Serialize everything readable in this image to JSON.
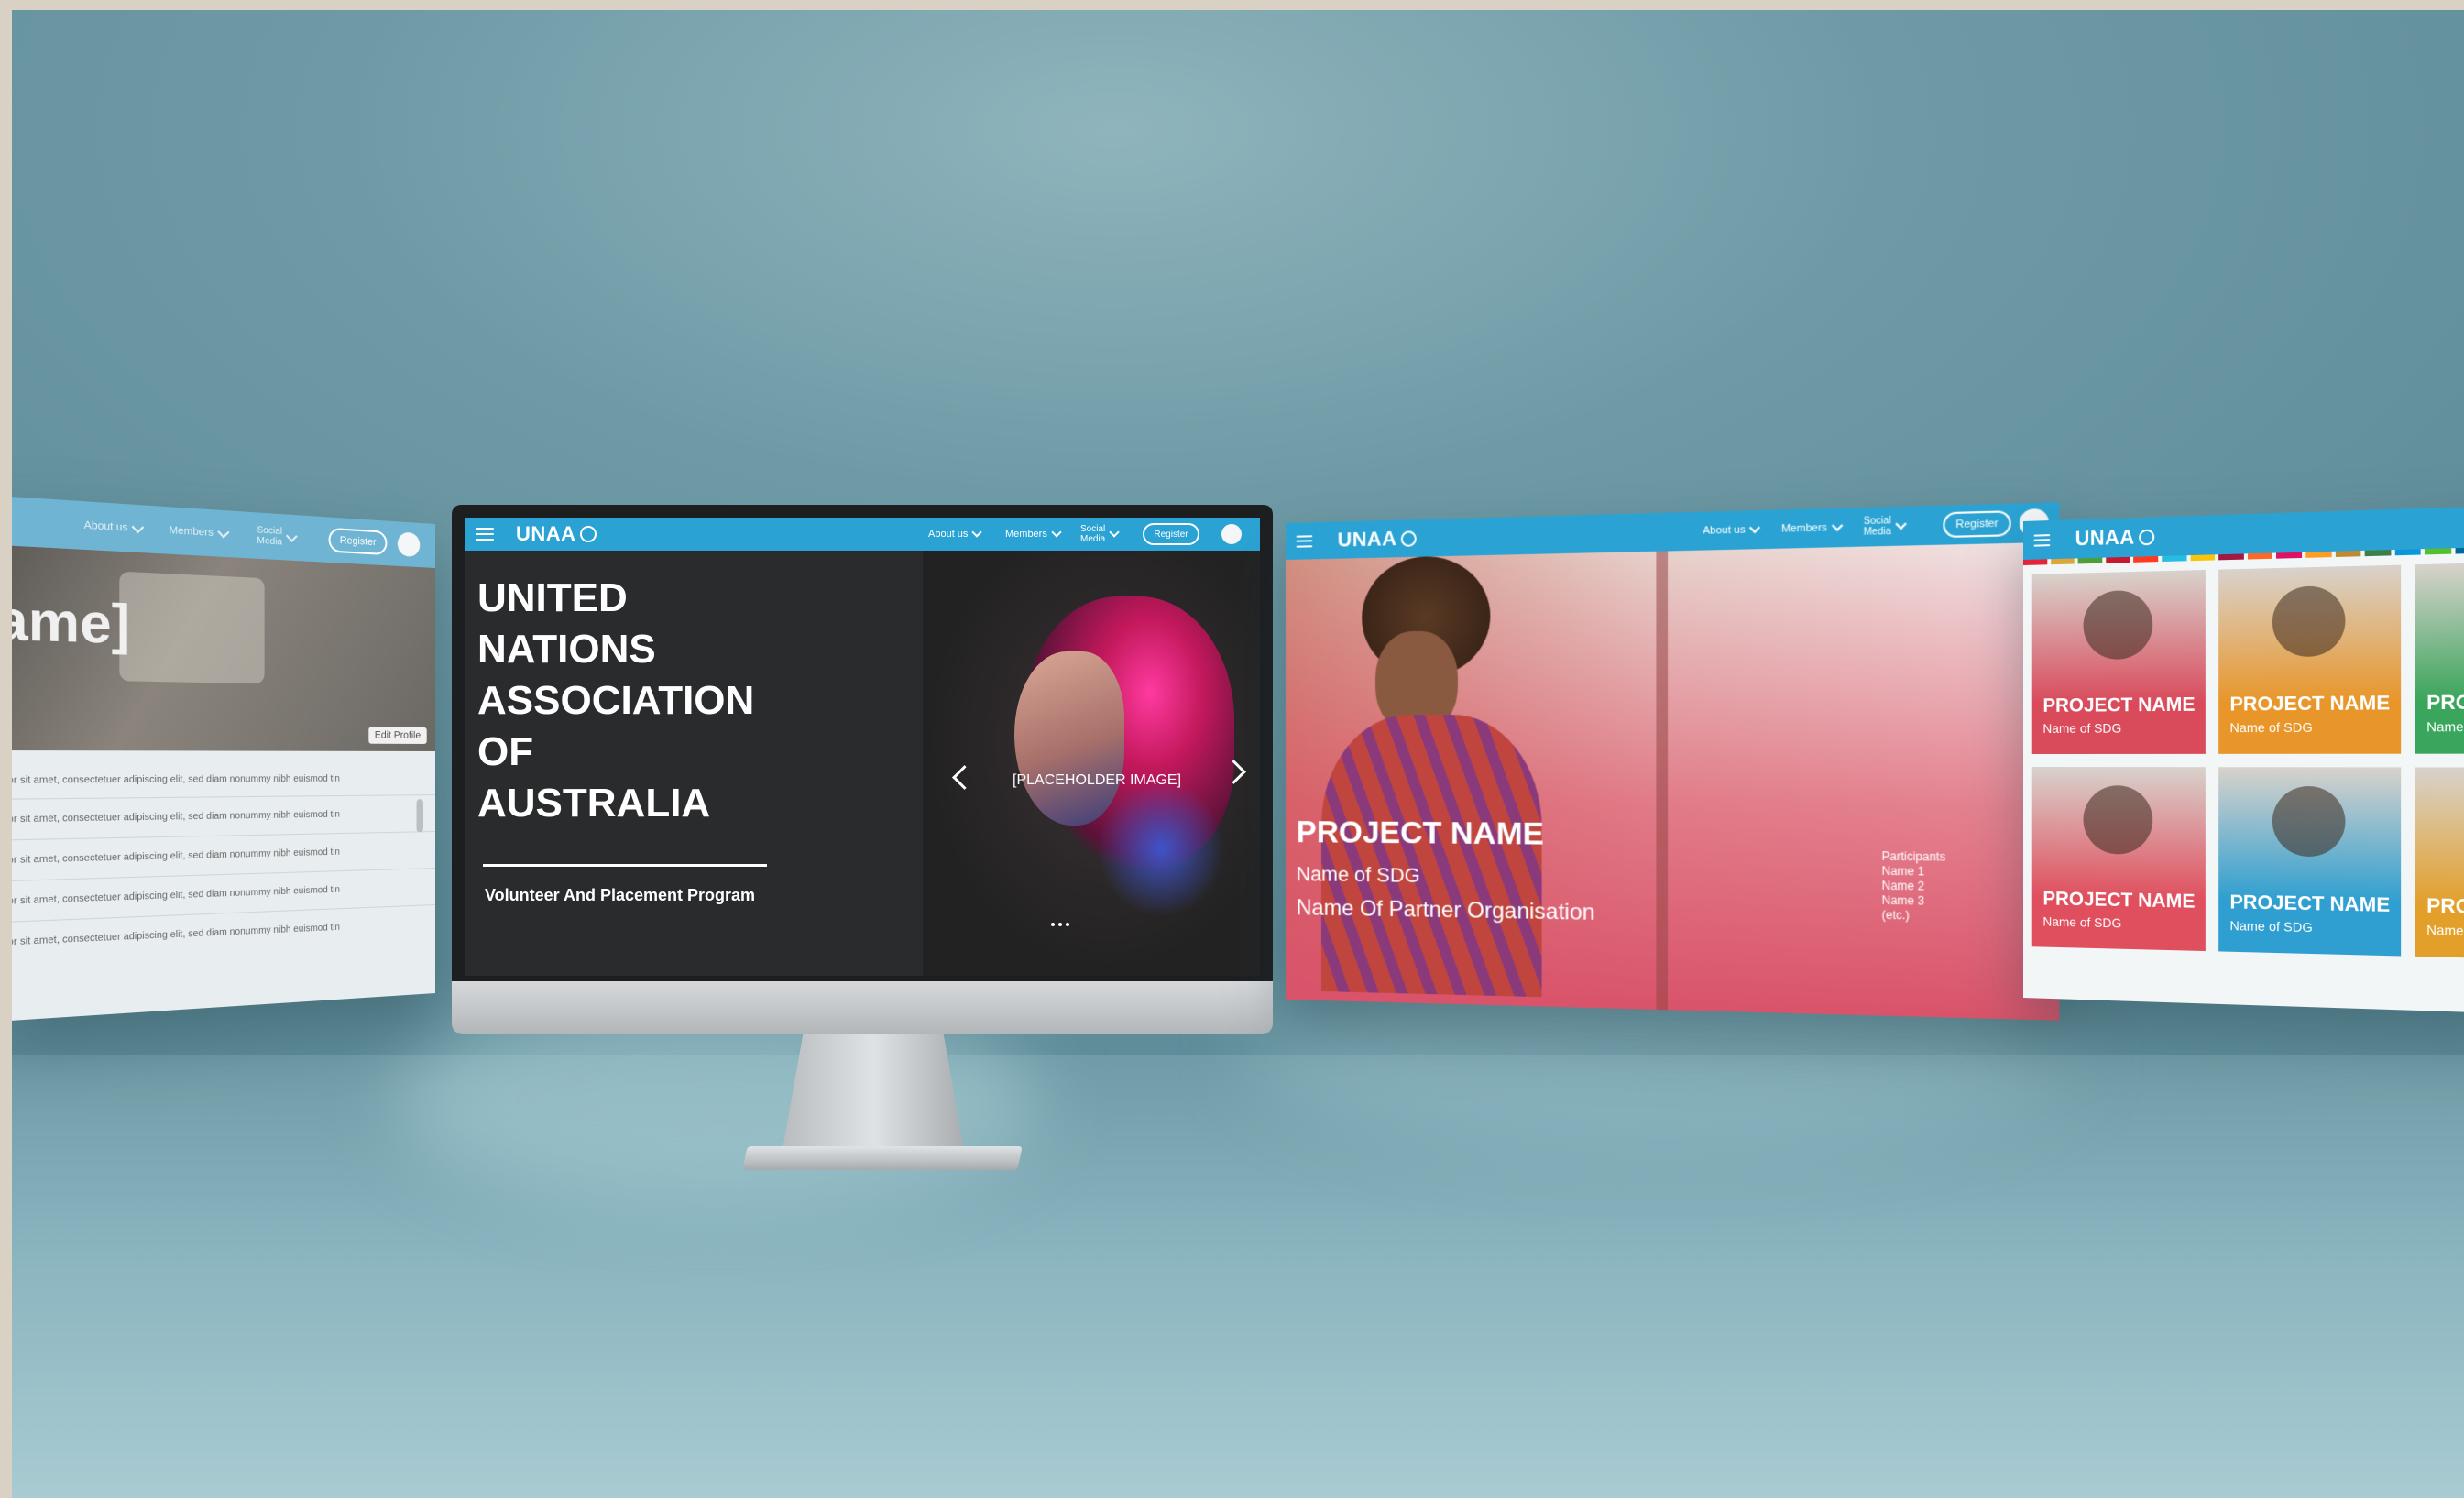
{
  "colors": {
    "nav": "#2aa3d4",
    "background": "#6e9aa6",
    "hero_dark": "#2a2b2d",
    "project_pink": "#d9536a"
  },
  "brand": {
    "logo_text": "UNAA"
  },
  "nav": {
    "about": "About us",
    "members": "Members",
    "social": "Social Media",
    "social_line1": "Social",
    "social_line2": "Media",
    "register": "Register"
  },
  "left_screen": {
    "title_fragment": "ame]",
    "edit_profile": "Edit Profile",
    "lines": [
      "olor sit amet, consectetuer adipiscing elit, sed diam nonummy nibh euismod tin",
      "olor sit amet, consectetuer adipiscing elit, sed diam nonummy nibh euismod tin",
      "olor sit amet, consectetuer adipiscing elit, sed diam nonummy nibh euismod tin",
      "olor sit amet, consectetuer adipiscing elit, sed diam nonummy nibh euismod tin",
      "olor sit amet, consectetuer adipiscing elit, sed diam nonummy nibh euismod tin"
    ]
  },
  "main_screen": {
    "title_lines": [
      "UNITED",
      "NATIONS",
      "ASSOCIATION",
      "OF",
      "AUSTRALIA"
    ],
    "subtitle": "Volunteer And Placement Program",
    "placeholder": "[PLACEHOLDER IMAGE]",
    "prev_icon": "chevron-left-icon",
    "next_icon": "chevron-right-icon"
  },
  "project_screen": {
    "project_name": "PROJECT NAME",
    "sdg": "Name of SDG",
    "partner": "Name Of Partner Organisation",
    "participants_label": "Participants",
    "participants": [
      "Name 1",
      "Name 2",
      "Name 3",
      "(etc.)"
    ]
  },
  "grid_screen": {
    "cards": [
      {
        "title": "PROJECT NAME",
        "sdg": "Name of SDG",
        "color": "#d94a5b"
      },
      {
        "title": "PROJECT NAME",
        "sdg": "Name of SDG",
        "color": "#e8962a"
      },
      {
        "title": "PROJE",
        "sdg": "Name of",
        "color": "#3aa55c"
      },
      {
        "title": "PROJECT NAME",
        "sdg": "Name of SDG",
        "color": "#e04f5e"
      },
      {
        "title": "PROJECT NAME",
        "sdg": "Name of SDG",
        "color": "#2e9fd0"
      },
      {
        "title": "PROJE",
        "sdg": "Name of",
        "color": "#e2a02b"
      }
    ],
    "sdg_stripe": [
      "#e5243b",
      "#dda63a",
      "#4c9f38",
      "#c5192d",
      "#ff3a21",
      "#26bde2",
      "#fcc30b",
      "#a21942",
      "#fd6925",
      "#dd1367",
      "#fd9d24",
      "#bf8b2e",
      "#3f7e44",
      "#0a97d9",
      "#56c02b",
      "#00689d",
      "#19486a"
    ]
  }
}
